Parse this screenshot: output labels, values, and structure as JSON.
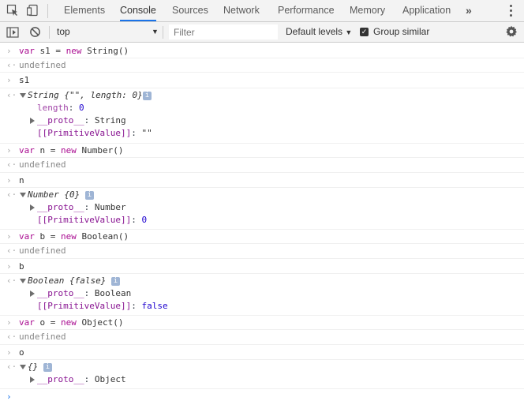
{
  "tabs": {
    "inspect_icon": "inspect-element-icon",
    "device_icon": "device-toolbar-icon",
    "items": [
      {
        "label": "Elements",
        "active": false
      },
      {
        "label": "Console",
        "active": true
      },
      {
        "label": "Sources",
        "active": false
      },
      {
        "label": "Network",
        "active": false
      },
      {
        "label": "Performance",
        "active": false
      },
      {
        "label": "Memory",
        "active": false
      },
      {
        "label": "Application",
        "active": false
      }
    ],
    "more_label": "»"
  },
  "toolbar": {
    "context_value": "top",
    "filter_placeholder": "Filter",
    "levels_label": "Default levels",
    "group_similar_label": "Group similar",
    "group_similar_checked": true
  },
  "console": {
    "entries": [
      {
        "input": "var s1 = new String()",
        "output": "undefined"
      },
      {
        "input": "s1",
        "object_header": "String {\"\", length: 0}",
        "props": [
          {
            "key": "length",
            "value": "0"
          },
          {
            "key": "__proto__",
            "value": "String"
          },
          {
            "key": "[[PrimitiveValue]]",
            "value": "\"\""
          }
        ]
      },
      {
        "input": "var n = new Number()",
        "output": "undefined"
      },
      {
        "input": "n",
        "object_header": "Number {0}",
        "props": [
          {
            "key": "__proto__",
            "value": "Number"
          },
          {
            "key": "[[PrimitiveValue]]",
            "value": "0"
          }
        ]
      },
      {
        "input": "var b = new Boolean()",
        "output": "undefined"
      },
      {
        "input": "b",
        "object_header": "Boolean {false}",
        "props": [
          {
            "key": "__proto__",
            "value": "Boolean"
          },
          {
            "key": "[[PrimitiveValue]]",
            "value": "false"
          }
        ]
      },
      {
        "input": "var o = new Object()",
        "output": "undefined"
      },
      {
        "input": "o",
        "object_header": "{}",
        "props": [
          {
            "key": "__proto__",
            "value": "Object"
          }
        ]
      }
    ],
    "prompt_symbol": "›",
    "result_symbol": "‹·",
    "info_icon": "i"
  },
  "colors": {
    "accent": "#1a73e8",
    "keyword": "#aa0d91",
    "property": "#881391"
  }
}
